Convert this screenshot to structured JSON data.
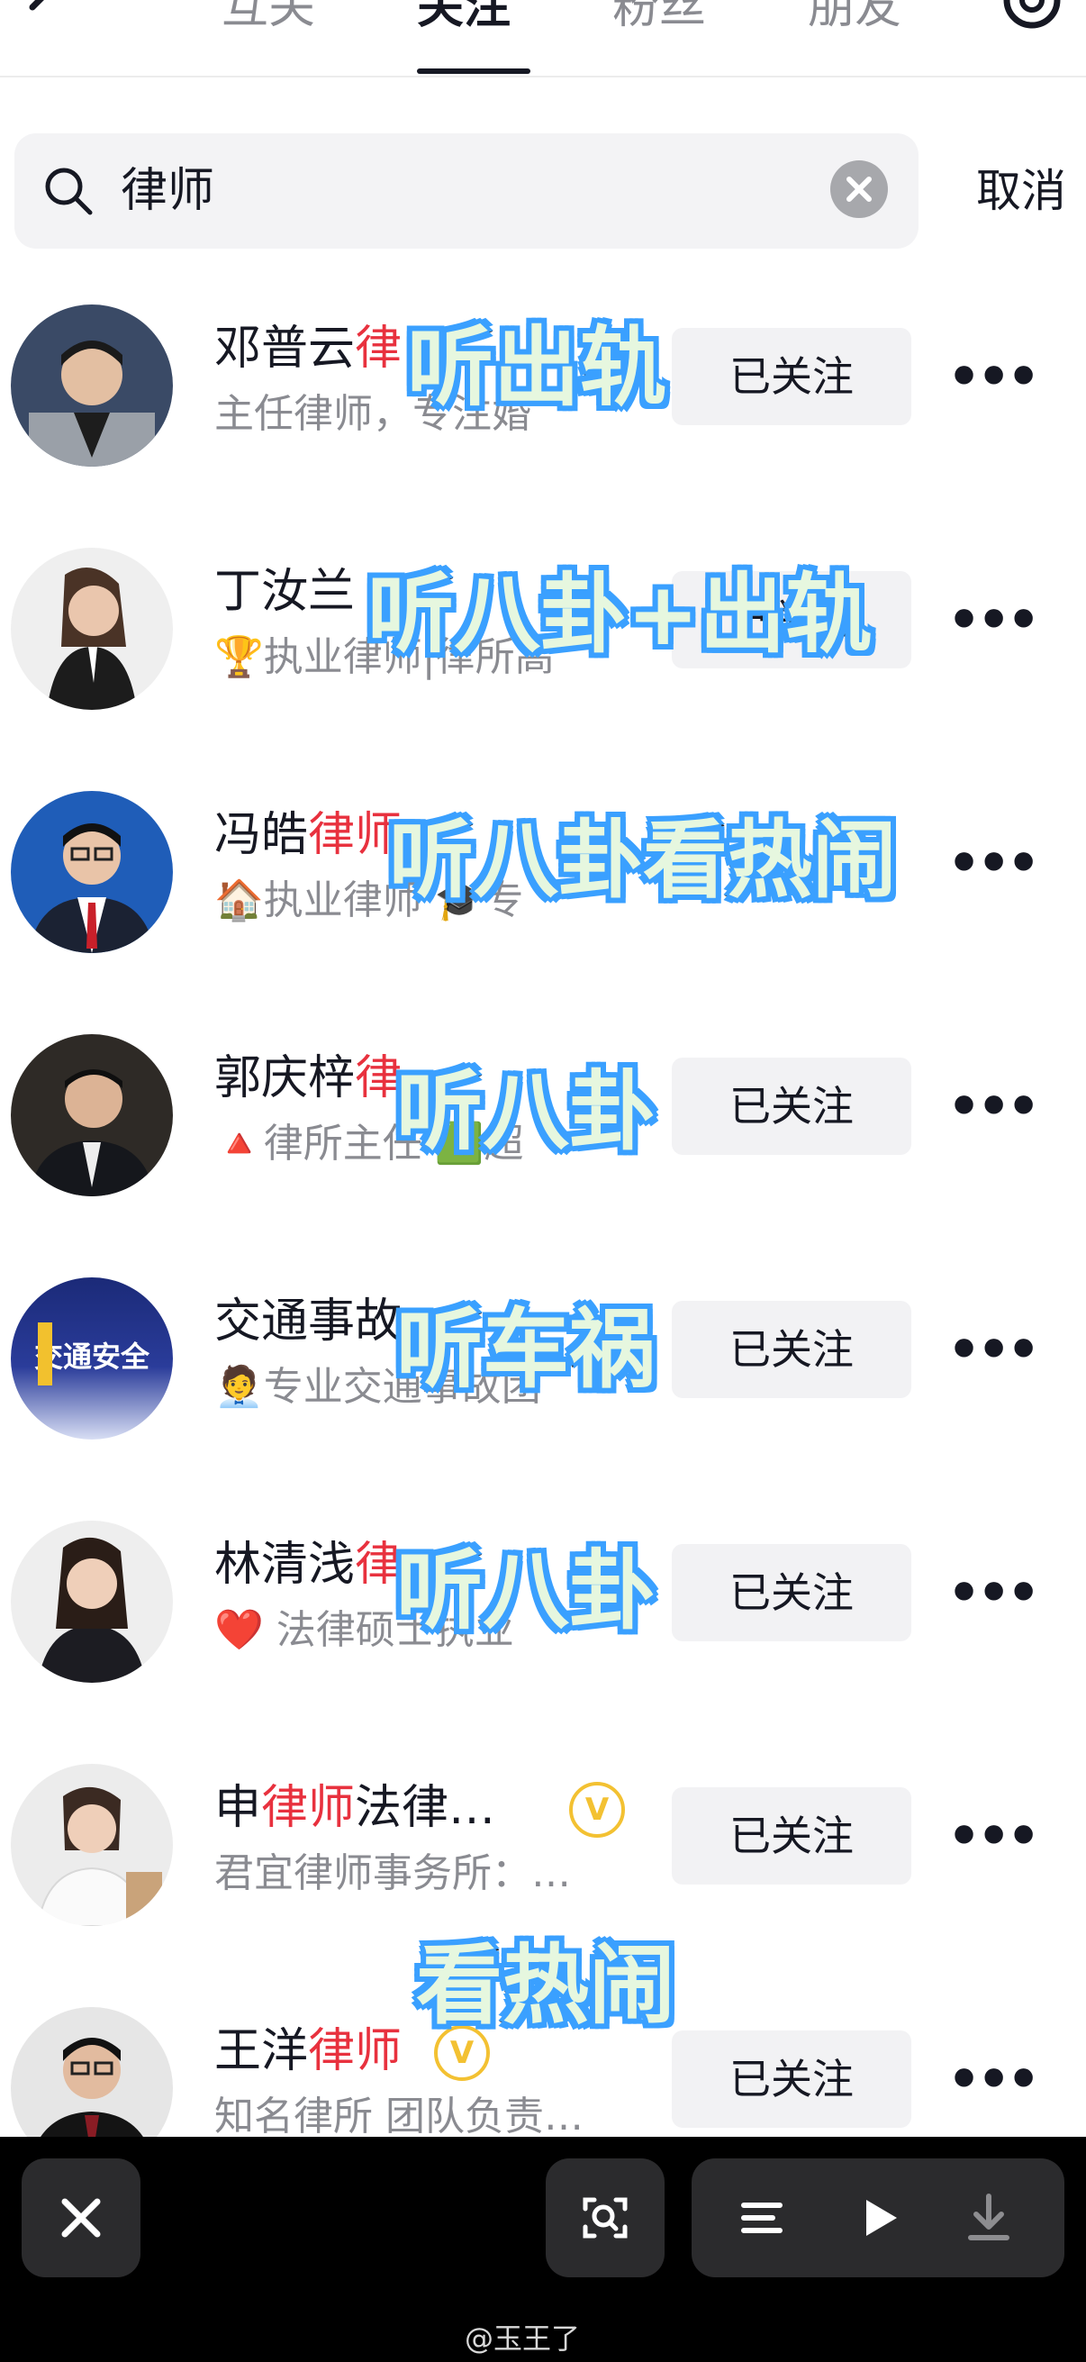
{
  "nav": {
    "tabs": [
      "互关",
      "关注",
      "粉丝",
      "朋友"
    ],
    "active_tab": "关注"
  },
  "search": {
    "value": "律师",
    "cancel_label": "取消"
  },
  "rows": [
    {
      "name_pre": "邓普云",
      "name_hl": "律",
      "name_post": "",
      "sub": "主任律师，专注婚",
      "follow": "已关注",
      "caption": "听出轨"
    },
    {
      "name_pre": "丁汝兰",
      "name_hl": "",
      "name_post": "",
      "sub": "🏆执业律师|律所高",
      "follow": "已关注",
      "caption": "听八卦+出轨"
    },
    {
      "name_pre": "冯皓",
      "name_hl": "律师",
      "name_post": "",
      "sub": "🏠执业律师 🎓专",
      "follow": "已关注",
      "caption": "听八卦看热闹"
    },
    {
      "name_pre": "郭庆梓",
      "name_hl": "律",
      "name_post": "",
      "sub": "🔺律所主任 🟩超",
      "follow": "已关注",
      "caption": "听八卦"
    },
    {
      "name_pre": "交通事故",
      "name_hl": "",
      "name_post": "",
      "sub": "🧑‍💼专业交通事故团",
      "follow": "已关注",
      "caption": "听车祸"
    },
    {
      "name_pre": "林清浅",
      "name_hl": "律",
      "name_post": "",
      "sub": "❤️ 法律硕士执业",
      "follow": "已关注",
      "caption": "听八卦"
    },
    {
      "name_pre": "申",
      "name_hl": "律师",
      "name_post": "法律…",
      "sub": "君宜律师事务所：…",
      "follow": "已关注",
      "caption": ""
    },
    {
      "name_pre": "王洋",
      "name_hl": "律师",
      "name_post": "",
      "sub": "知名律所 团队负责…",
      "follow": "已关注",
      "caption": ""
    }
  ],
  "bottom_caption": "看热闹",
  "avatar5_text": "交通安全",
  "vbadge": "V",
  "watermark": "@玉王了",
  "colors": {
    "highlight": "#e8313e",
    "caption_fill": "#e6f7df",
    "caption_glow": "#3aa0ff",
    "badge": "#f3c132"
  },
  "icons": {
    "back": "chevron-left-icon",
    "settings": "gear-icon",
    "search": "search-icon",
    "clear": "clear-circle-icon",
    "more": "more-dots-icon",
    "close": "close-icon",
    "scan": "scan-icon",
    "menu": "menu-icon",
    "play": "play-icon",
    "download": "download-icon"
  }
}
